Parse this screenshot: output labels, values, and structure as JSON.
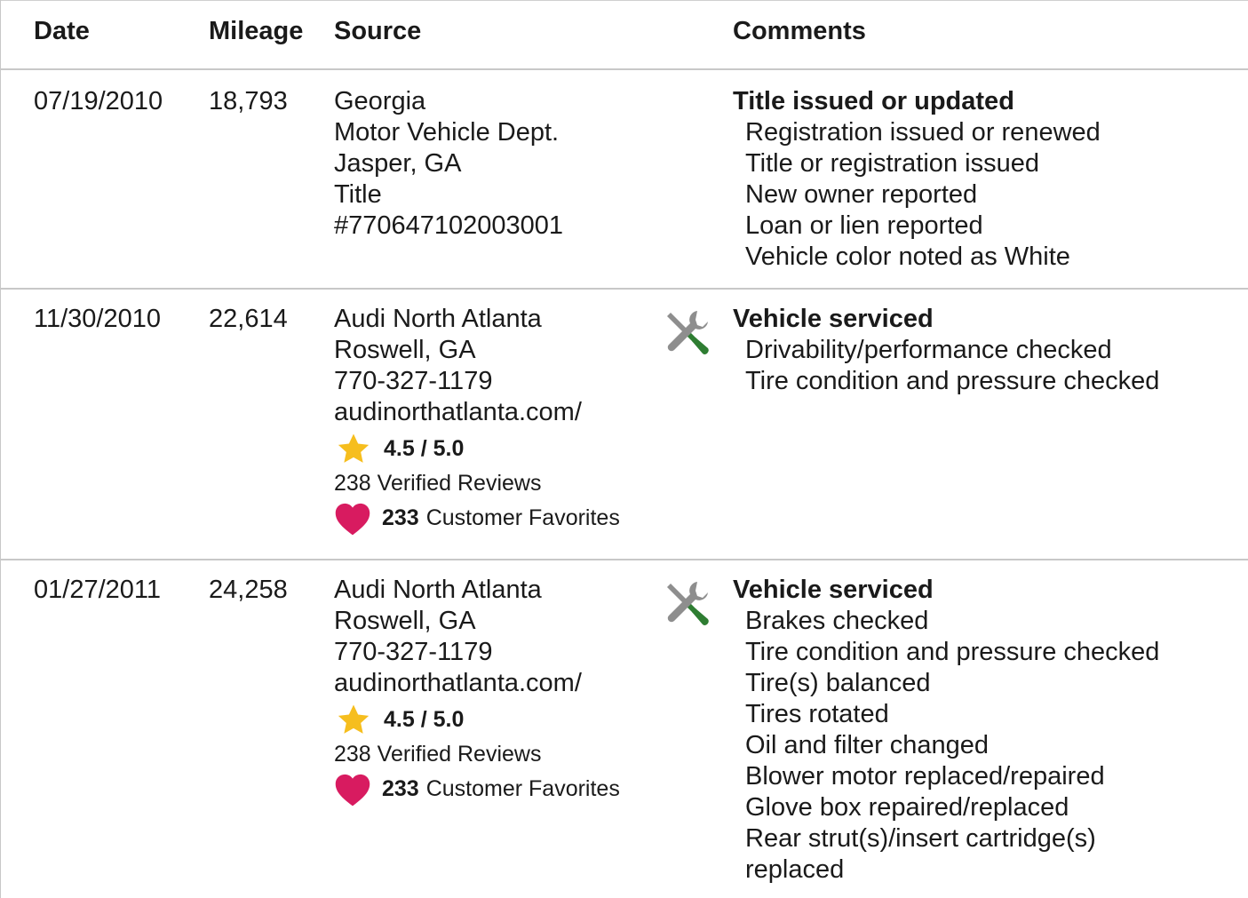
{
  "header": {
    "date": "Date",
    "mileage": "Mileage",
    "source": "Source",
    "comments": "Comments"
  },
  "rows": [
    {
      "date": "07/19/2010",
      "mileage": "18,793",
      "source": [
        "Georgia",
        "Motor Vehicle Dept.",
        "Jasper, GA",
        "Title",
        "#770647102003001"
      ],
      "comment_title": "Title issued or updated",
      "comment_items": [
        "Registration issued or renewed",
        "Title or registration issued",
        "New owner reported",
        "Loan or lien reported",
        "Vehicle color noted as White"
      ]
    },
    {
      "date": "11/30/2010",
      "mileage": "22,614",
      "source": [
        "Audi North Atlanta",
        "Roswell, GA",
        "770-327-1179",
        "audinorthatlanta.com/"
      ],
      "rating": "4.5 / 5.0",
      "reviews": "238 Verified Reviews",
      "favorites_count": "233",
      "favorites_label": "Customer Favorites",
      "icon": "service-tools-icon",
      "comment_title": "Vehicle serviced",
      "comment_items": [
        "Drivability/performance checked",
        "Tire condition and pressure checked"
      ]
    },
    {
      "date": "01/27/2011",
      "mileage": "24,258",
      "source": [
        "Audi North Atlanta",
        "Roswell, GA",
        "770-327-1179",
        "audinorthatlanta.com/"
      ],
      "rating": "4.5 / 5.0",
      "reviews": "238 Verified Reviews",
      "favorites_count": "233",
      "favorites_label": "Customer Favorites",
      "icon": "service-tools-icon",
      "comment_title": "Vehicle serviced",
      "comment_items": [
        "Brakes checked",
        "Tire condition and pressure checked",
        "Tire(s) balanced",
        "Tires rotated",
        "Oil and filter changed",
        "Blower motor replaced/repaired",
        "Glove box repaired/replaced",
        "Rear strut(s)/insert cartridge(s)",
        "replaced"
      ]
    }
  ],
  "colors": {
    "star": "#F6BE1E",
    "heart": "#D81B60",
    "wrench": "#8E8E8E",
    "screwdriver": "#2E7D32",
    "divider": "#C8C8C8"
  }
}
